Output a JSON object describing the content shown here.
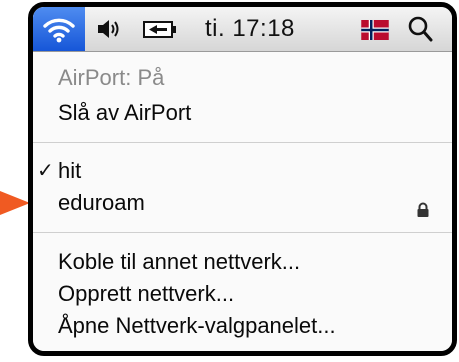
{
  "menubar": {
    "wifi_icon": "wifi-icon",
    "speaker_icon": "speaker-icon",
    "battery_icon": "battery-icon",
    "clock": "ti. 17:18",
    "flag_icon": "norway-flag-icon",
    "spotlight_icon": "spotlight-search-icon"
  },
  "menu": {
    "status": "AirPort: På",
    "toggle": "Slå av AirPort",
    "networks": [
      {
        "name": "hit",
        "checked": true,
        "locked": false
      },
      {
        "name": "eduroam",
        "checked": false,
        "locked": true
      }
    ],
    "actions": [
      "Koble til annet nettverk...",
      "Opprett nettverk...",
      "Åpne Nettverk-valgpanelet..."
    ],
    "check_glyph": "✓"
  },
  "colors": {
    "wifi_highlight": "#2b6de4",
    "arrow": "#f05a22",
    "disabled_text": "#8a8a8a"
  }
}
